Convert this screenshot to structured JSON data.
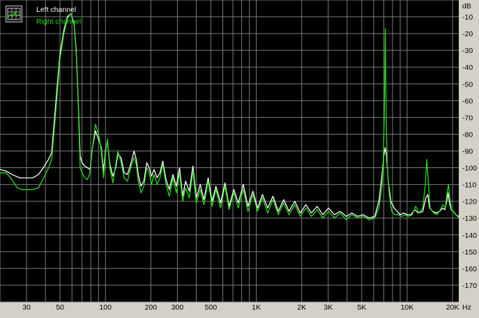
{
  "chart_data": {
    "type": "line",
    "title": "",
    "xlabel": "",
    "ylabel": "",
    "x_unit": "Hz",
    "y_unit": "dB",
    "x_scale": "log",
    "xlim": [
      20,
      22000
    ],
    "ylim": [
      -180,
      0
    ],
    "grid": true,
    "legend_position": "top-left",
    "background_color": "#000000",
    "grid_color": "#7c7c7c",
    "x_ticks": [
      {
        "value": 30,
        "label": "30"
      },
      {
        "value": 50,
        "label": "50"
      },
      {
        "value": 100,
        "label": "100"
      },
      {
        "value": 200,
        "label": "200"
      },
      {
        "value": 300,
        "label": "300"
      },
      {
        "value": 500,
        "label": "500"
      },
      {
        "value": 1000,
        "label": "1K"
      },
      {
        "value": 2000,
        "label": "2K"
      },
      {
        "value": 3000,
        "label": "3K"
      },
      {
        "value": 5000,
        "label": "5K"
      },
      {
        "value": 10000,
        "label": "10K"
      },
      {
        "value": 20000,
        "label": "20K"
      }
    ],
    "y_ticks": [
      {
        "value": -10,
        "label": "-10"
      },
      {
        "value": -20,
        "label": "-20"
      },
      {
        "value": -30,
        "label": "-30"
      },
      {
        "value": -40,
        "label": "-40"
      },
      {
        "value": -50,
        "label": "-50"
      },
      {
        "value": -60,
        "label": "-60"
      },
      {
        "value": -70,
        "label": "-70"
      },
      {
        "value": -80,
        "label": "-80"
      },
      {
        "value": -90,
        "label": "-90"
      },
      {
        "value": -100,
        "label": "-100"
      },
      {
        "value": -110,
        "label": "-110"
      },
      {
        "value": -120,
        "label": "-120"
      },
      {
        "value": -130,
        "label": "-130"
      },
      {
        "value": -140,
        "label": "-140"
      },
      {
        "value": -150,
        "label": "-150"
      },
      {
        "value": -160,
        "label": "-160"
      },
      {
        "value": -170,
        "label": "-170"
      }
    ],
    "series": [
      {
        "name": "Left channel",
        "color": "#ffffff",
        "points": [
          [
            20,
            -101
          ],
          [
            22,
            -102
          ],
          [
            24,
            -104
          ],
          [
            27,
            -106
          ],
          [
            30,
            -106
          ],
          [
            33,
            -106
          ],
          [
            36,
            -104
          ],
          [
            38,
            -101
          ],
          [
            40,
            -98
          ],
          [
            42,
            -95
          ],
          [
            44,
            -91
          ],
          [
            46,
            -70
          ],
          [
            48,
            -50
          ],
          [
            50,
            -32
          ],
          [
            53,
            -18
          ],
          [
            56,
            -10
          ],
          [
            59,
            -8
          ],
          [
            62,
            -14
          ],
          [
            64,
            -30
          ],
          [
            66,
            -60
          ],
          [
            68,
            -93
          ],
          [
            70,
            -97
          ],
          [
            73,
            -99
          ],
          [
            76,
            -100
          ],
          [
            79,
            -101
          ],
          [
            82,
            -88
          ],
          [
            86,
            -78
          ],
          [
            90,
            -83
          ],
          [
            94,
            -88
          ],
          [
            97,
            -102
          ],
          [
            100,
            -90
          ],
          [
            103,
            -84
          ],
          [
            107,
            -98
          ],
          [
            112,
            -105
          ],
          [
            117,
            -100
          ],
          [
            121,
            -92
          ],
          [
            127,
            -94
          ],
          [
            133,
            -103
          ],
          [
            140,
            -104
          ],
          [
            147,
            -98
          ],
          [
            155,
            -90
          ],
          [
            160,
            -95
          ],
          [
            165,
            -104
          ],
          [
            172,
            -111
          ],
          [
            180,
            -108
          ],
          [
            188,
            -97
          ],
          [
            195,
            -100
          ],
          [
            202,
            -105
          ],
          [
            210,
            -101
          ],
          [
            220,
            -106
          ],
          [
            230,
            -103
          ],
          [
            240,
            -96
          ],
          [
            252,
            -107
          ],
          [
            265,
            -113
          ],
          [
            280,
            -104
          ],
          [
            295,
            -111
          ],
          [
            310,
            -100
          ],
          [
            325,
            -117
          ],
          [
            340,
            -108
          ],
          [
            360,
            -114
          ],
          [
            380,
            -99
          ],
          [
            400,
            -118
          ],
          [
            425,
            -110
          ],
          [
            450,
            -119
          ],
          [
            480,
            -106
          ],
          [
            510,
            -120
          ],
          [
            540,
            -111
          ],
          [
            580,
            -121
          ],
          [
            620,
            -109
          ],
          [
            660,
            -123
          ],
          [
            710,
            -113
          ],
          [
            760,
            -121
          ],
          [
            820,
            -110
          ],
          [
            880,
            -123
          ],
          [
            950,
            -114
          ],
          [
            1020,
            -124
          ],
          [
            1100,
            -116
          ],
          [
            1190,
            -124
          ],
          [
            1290,
            -117
          ],
          [
            1400,
            -126
          ],
          [
            1520,
            -119
          ],
          [
            1650,
            -126
          ],
          [
            1800,
            -120
          ],
          [
            1960,
            -127
          ],
          [
            2130,
            -122
          ],
          [
            2320,
            -127
          ],
          [
            2530,
            -123
          ],
          [
            2760,
            -128
          ],
          [
            3010,
            -124
          ],
          [
            3300,
            -128
          ],
          [
            3600,
            -126
          ],
          [
            3950,
            -129
          ],
          [
            4300,
            -127
          ],
          [
            4700,
            -129
          ],
          [
            5100,
            -128
          ],
          [
            5600,
            -130
          ],
          [
            6100,
            -129
          ],
          [
            6500,
            -120
          ],
          [
            6800,
            -105
          ],
          [
            7000,
            -93
          ],
          [
            7150,
            -88
          ],
          [
            7300,
            -93
          ],
          [
            7500,
            -108
          ],
          [
            7800,
            -120
          ],
          [
            8200,
            -124
          ],
          [
            8600,
            -126
          ],
          [
            9000,
            -128
          ],
          [
            9500,
            -127
          ],
          [
            10000,
            -128
          ],
          [
            10600,
            -128
          ],
          [
            11200,
            -125
          ],
          [
            11900,
            -127
          ],
          [
            12700,
            -126
          ],
          [
            13300,
            -118
          ],
          [
            13700,
            -116
          ],
          [
            14100,
            -124
          ],
          [
            14800,
            -126
          ],
          [
            15600,
            -127
          ],
          [
            16400,
            -126
          ],
          [
            17200,
            -124
          ],
          [
            17800,
            -125
          ],
          [
            18300,
            -120
          ],
          [
            18700,
            -115
          ],
          [
            19100,
            -121
          ],
          [
            19600,
            -125
          ],
          [
            20200,
            -126
          ],
          [
            21000,
            -128
          ],
          [
            22000,
            -129
          ]
        ]
      },
      {
        "name": "Right channel",
        "color": "#24e014",
        "points": [
          [
            20,
            -103
          ],
          [
            22,
            -103
          ],
          [
            24,
            -107
          ],
          [
            26,
            -112
          ],
          [
            28,
            -113
          ],
          [
            30,
            -113
          ],
          [
            33,
            -113
          ],
          [
            36,
            -112
          ],
          [
            38,
            -108
          ],
          [
            40,
            -104
          ],
          [
            42,
            -100
          ],
          [
            44,
            -95
          ],
          [
            46,
            -75
          ],
          [
            48,
            -55
          ],
          [
            50,
            -35
          ],
          [
            53,
            -20
          ],
          [
            56,
            -11
          ],
          [
            59,
            -8
          ],
          [
            62,
            -15
          ],
          [
            64,
            -32
          ],
          [
            66,
            -62
          ],
          [
            68,
            -100
          ],
          [
            70,
            -103
          ],
          [
            73,
            -106
          ],
          [
            76,
            -107
          ],
          [
            79,
            -103
          ],
          [
            82,
            -88
          ],
          [
            86,
            -74
          ],
          [
            90,
            -80
          ],
          [
            94,
            -90
          ],
          [
            97,
            -106
          ],
          [
            100,
            -92
          ],
          [
            103,
            -83
          ],
          [
            107,
            -100
          ],
          [
            112,
            -109
          ],
          [
            117,
            -98
          ],
          [
            121,
            -90
          ],
          [
            127,
            -97
          ],
          [
            133,
            -106
          ],
          [
            140,
            -108
          ],
          [
            147,
            -100
          ],
          [
            155,
            -94
          ],
          [
            160,
            -98
          ],
          [
            165,
            -108
          ],
          [
            172,
            -115
          ],
          [
            180,
            -111
          ],
          [
            188,
            -100
          ],
          [
            195,
            -103
          ],
          [
            202,
            -110
          ],
          [
            210,
            -104
          ],
          [
            220,
            -110
          ],
          [
            230,
            -106
          ],
          [
            240,
            -98
          ],
          [
            252,
            -110
          ],
          [
            265,
            -117
          ],
          [
            280,
            -106
          ],
          [
            295,
            -115
          ],
          [
            310,
            -103
          ],
          [
            325,
            -120
          ],
          [
            340,
            -112
          ],
          [
            360,
            -118
          ],
          [
            380,
            -102
          ],
          [
            400,
            -121
          ],
          [
            425,
            -113
          ],
          [
            450,
            -122
          ],
          [
            480,
            -108
          ],
          [
            510,
            -123
          ],
          [
            540,
            -113
          ],
          [
            580,
            -124
          ],
          [
            620,
            -111
          ],
          [
            660,
            -125
          ],
          [
            710,
            -115
          ],
          [
            760,
            -124
          ],
          [
            820,
            -113
          ],
          [
            880,
            -126
          ],
          [
            950,
            -116
          ],
          [
            1020,
            -126
          ],
          [
            1100,
            -118
          ],
          [
            1190,
            -127
          ],
          [
            1290,
            -119
          ],
          [
            1400,
            -128
          ],
          [
            1520,
            -121
          ],
          [
            1650,
            -128
          ],
          [
            1800,
            -122
          ],
          [
            1960,
            -129
          ],
          [
            2130,
            -124
          ],
          [
            2320,
            -129
          ],
          [
            2530,
            -125
          ],
          [
            2760,
            -130
          ],
          [
            3010,
            -126
          ],
          [
            3300,
            -130
          ],
          [
            3600,
            -127
          ],
          [
            3950,
            -131
          ],
          [
            4300,
            -128
          ],
          [
            4700,
            -130
          ],
          [
            5100,
            -129
          ],
          [
            5600,
            -131
          ],
          [
            6100,
            -130
          ],
          [
            6500,
            -124
          ],
          [
            6800,
            -112
          ],
          [
            6950,
            -97
          ],
          [
            7050,
            -70
          ],
          [
            7120,
            -40
          ],
          [
            7160,
            -17
          ],
          [
            7200,
            -40
          ],
          [
            7280,
            -75
          ],
          [
            7400,
            -100
          ],
          [
            7600,
            -115
          ],
          [
            7900,
            -126
          ],
          [
            8300,
            -128
          ],
          [
            8700,
            -128
          ],
          [
            9200,
            -129
          ],
          [
            9700,
            -128
          ],
          [
            10200,
            -129
          ],
          [
            10800,
            -128
          ],
          [
            11400,
            -123
          ],
          [
            12000,
            -127
          ],
          [
            12700,
            -124
          ],
          [
            13200,
            -110
          ],
          [
            13500,
            -95
          ],
          [
            13800,
            -108
          ],
          [
            14200,
            -124
          ],
          [
            15000,
            -127
          ],
          [
            15800,
            -128
          ],
          [
            16600,
            -125
          ],
          [
            17300,
            -122
          ],
          [
            17900,
            -124
          ],
          [
            18400,
            -115
          ],
          [
            18800,
            -110
          ],
          [
            19200,
            -118
          ],
          [
            19700,
            -125
          ],
          [
            20300,
            -126
          ],
          [
            21100,
            -128
          ],
          [
            22000,
            -130
          ]
        ]
      }
    ]
  }
}
